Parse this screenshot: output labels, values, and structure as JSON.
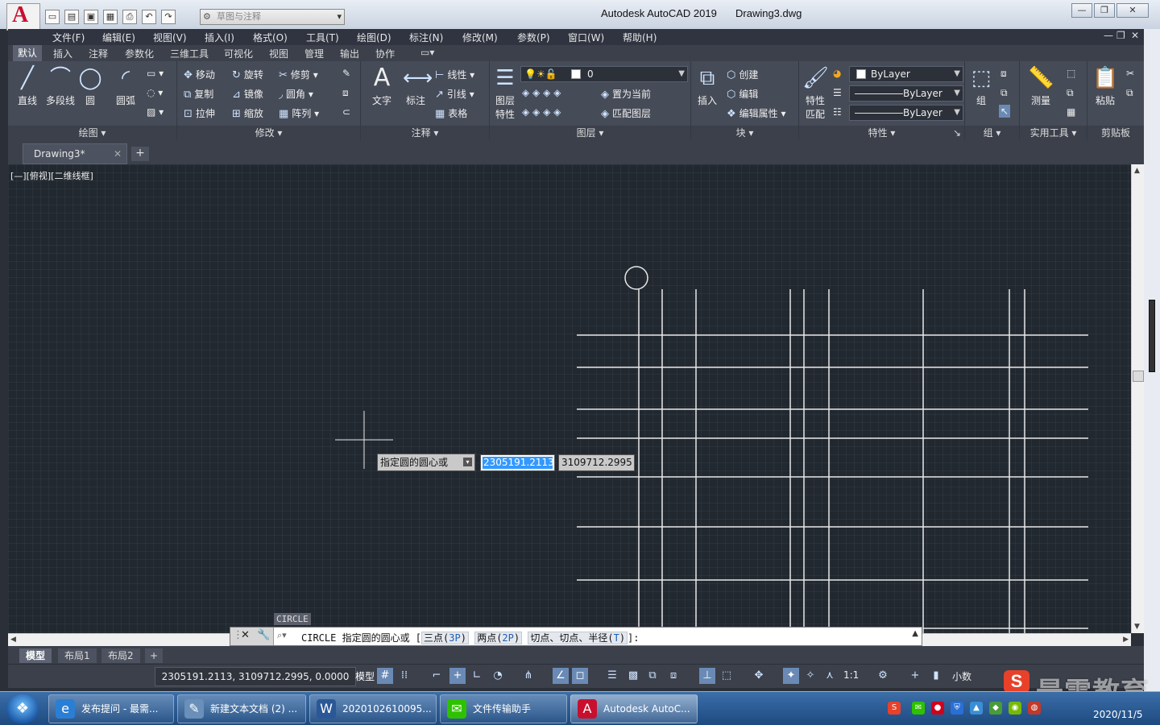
{
  "titlebar": {
    "app_title": "Autodesk AutoCAD 2019",
    "file_name": "Drawing3.dwg",
    "workspace": "草图与注释",
    "logo": "A"
  },
  "menubar": {
    "items": [
      "文件(F)",
      "编辑(E)",
      "视图(V)",
      "插入(I)",
      "格式(O)",
      "工具(T)",
      "绘图(D)",
      "标注(N)",
      "修改(M)",
      "参数(P)",
      "窗口(W)",
      "帮助(H)"
    ]
  },
  "ribbon_tabs": [
    "默认",
    "插入",
    "注释",
    "参数化",
    "三维工具",
    "可视化",
    "视图",
    "管理",
    "输出",
    "协作"
  ],
  "ribbon": {
    "draw": {
      "title": "绘图",
      "line": "直线",
      "polyline": "多段线",
      "circle": "圆",
      "arc": "圆弧"
    },
    "modify": {
      "title": "修改",
      "move": "移动",
      "rotate": "旋转",
      "trim": "修剪",
      "copy": "复制",
      "mirror": "镜像",
      "fillet": "圆角",
      "stretch": "拉伸",
      "scale": "缩放",
      "array": "阵列"
    },
    "annotation": {
      "title": "注释",
      "text": "文字",
      "dimension": "标注",
      "linear": "线性",
      "leader": "引线",
      "table": "表格"
    },
    "layers": {
      "title": "图层",
      "layer_props_1": "图层",
      "layer_props_2": "特性",
      "current_layer": "0",
      "set_current": "置为当前",
      "match_layer": "匹配图层"
    },
    "block": {
      "title": "块",
      "insert": "插入",
      "create": "创建",
      "edit": "编辑",
      "edit_attr": "编辑属性"
    },
    "properties": {
      "title": "特性",
      "match_1": "特性",
      "match_2": "匹配",
      "color": "ByLayer",
      "linetype": "ByLayer",
      "lineweight": "ByLayer"
    },
    "groups": {
      "title": "组",
      "group": "组"
    },
    "utilities": {
      "title": "实用工具",
      "measure": "测量"
    },
    "clipboard": {
      "title": "剪贴板",
      "paste": "粘贴"
    }
  },
  "file_tabs": {
    "doc": "Drawing3*"
  },
  "viewport_label": "[—][俯视][二维线框]",
  "dynamic_input": {
    "prompt": "指定圆的圆心或",
    "x": "2305191.2113",
    "y": "3109712.2995"
  },
  "command": {
    "history": "CIRCLE",
    "prefix": "CIRCLE 指定圆的圆心或 [",
    "opt1_label": "三点(",
    "opt1_key": "3P",
    "opt1_end": ")",
    "opt2_label": "两点(",
    "opt2_key": "2P",
    "opt2_end": ")",
    "opt3_label": "切点、切点、半径(",
    "opt3_key": "T",
    "opt3_end": ")",
    "suffix": "]:"
  },
  "layout_tabs": [
    "模型",
    "布局1",
    "布局2"
  ],
  "statusbar": {
    "coordinates": "2305191.2113, 3109712.2995, 0.0000",
    "model": "模型",
    "scale": "1:1",
    "units": "小数"
  },
  "taskbar": {
    "items": [
      {
        "label": "发布提问 - 最需...",
        "icon": "ie-icon",
        "color": "#2a7fd4"
      },
      {
        "label": "新建文本文档 (2) ...",
        "icon": "notepad-icon",
        "color": "#6a8fb8"
      },
      {
        "label": "2020102610095...",
        "icon": "word-icon",
        "color": "#2b5797"
      },
      {
        "label": "文件传输助手",
        "icon": "wechat-icon",
        "color": "#2dc100"
      },
      {
        "label": "Autodesk AutoC...",
        "icon": "autocad-icon",
        "color": "#c8102e"
      }
    ],
    "date": "2020/11/5"
  },
  "watermark": {
    "text": "最需教育",
    "logo": "S"
  },
  "colors": {
    "canvas": "#212830",
    "ribbon": "#454b57",
    "accent": "#3399ff"
  }
}
